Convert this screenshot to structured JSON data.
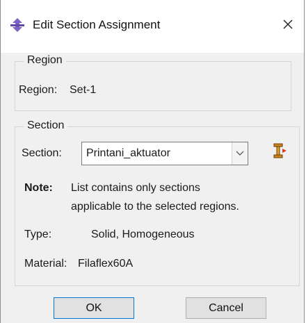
{
  "window": {
    "title": "Edit Section Assignment"
  },
  "region_group": {
    "legend": "Region",
    "label": "Region:",
    "value": "Set-1"
  },
  "section_group": {
    "legend": "Section",
    "section_label": "Section:",
    "section_value": "Printani_aktuator",
    "note_label": "Note:",
    "note_line1": "List contains only sections",
    "note_line2": "applicable to the selected regions.",
    "type_label": "Type:",
    "type_value": "Solid, Homogeneous",
    "material_label": "Material:",
    "material_value": "Filaflex60A"
  },
  "buttons": {
    "ok": "OK",
    "cancel": "Cancel"
  },
  "icons": {
    "title": "section-assignment-icon",
    "create": "create-section-icon",
    "close": "close-icon",
    "dropdown": "chevron-down-icon"
  },
  "colors": {
    "title_icon": "#7b62c4",
    "tool_icon": "#c8861c",
    "default_button_border": "#0078d7"
  }
}
